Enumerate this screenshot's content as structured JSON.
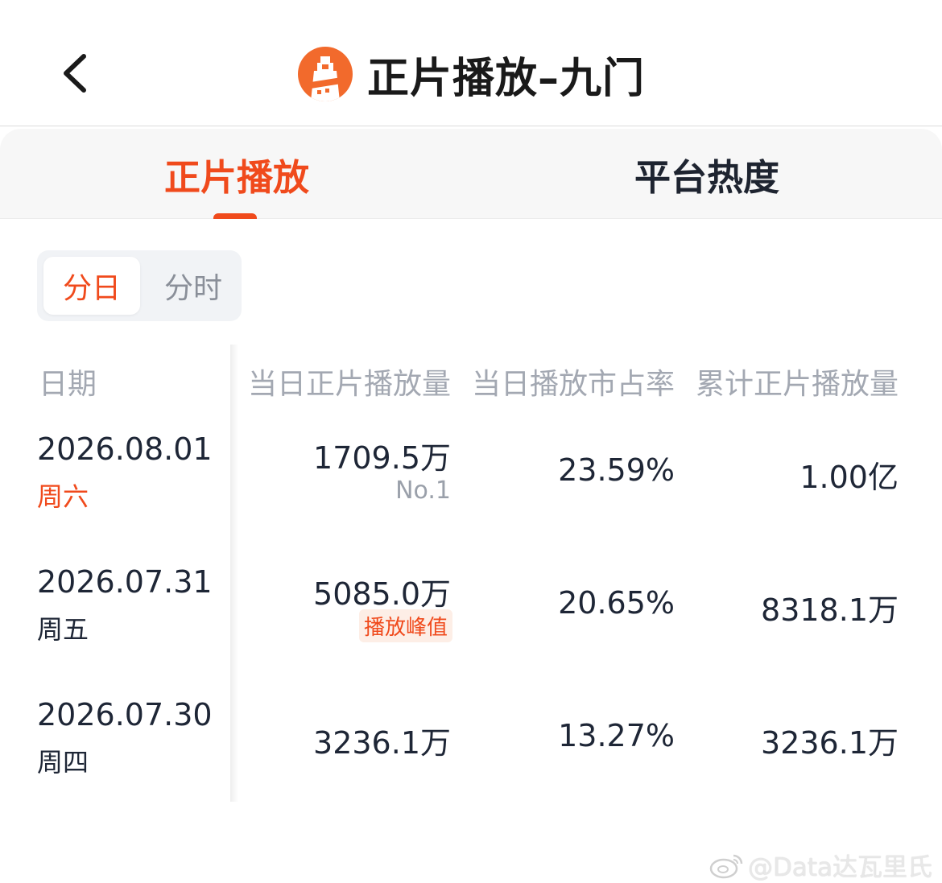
{
  "header": {
    "title": "正片播放–九门",
    "logo_icon": "film-tower-logo-icon"
  },
  "tabs": [
    {
      "label": "正片播放",
      "active": true
    },
    {
      "label": "平台热度",
      "active": false
    }
  ],
  "granularity": {
    "options": [
      {
        "label": "分日",
        "active": true
      },
      {
        "label": "分时",
        "active": false
      }
    ]
  },
  "table": {
    "headers": {
      "date": "日期",
      "daily_plays": "当日正片播放量",
      "market_share": "当日播放市占率",
      "cumulative": "累计正片播放量"
    },
    "rows": [
      {
        "date": "2026.08.01",
        "weekday": "周六",
        "daily_plays": "1709.5万",
        "note": "No.1",
        "market_share": "23.59%",
        "cumulative": "1.00亿"
      },
      {
        "date": "2026.07.31",
        "weekday": "周五",
        "daily_plays": "5085.0万",
        "badge": "播放峰值",
        "market_share": "20.65%",
        "cumulative": "8318.1万"
      },
      {
        "date": "2026.07.30",
        "weekday": "周四",
        "daily_plays": "3236.1万",
        "market_share": "13.27%",
        "cumulative": "3236.1万"
      }
    ]
  },
  "watermark": "@Data达瓦里氏",
  "colors": {
    "accent": "#f04a1c",
    "logo": "#f26a2c",
    "text": "#1e2636",
    "muted": "#a3a8b2"
  }
}
